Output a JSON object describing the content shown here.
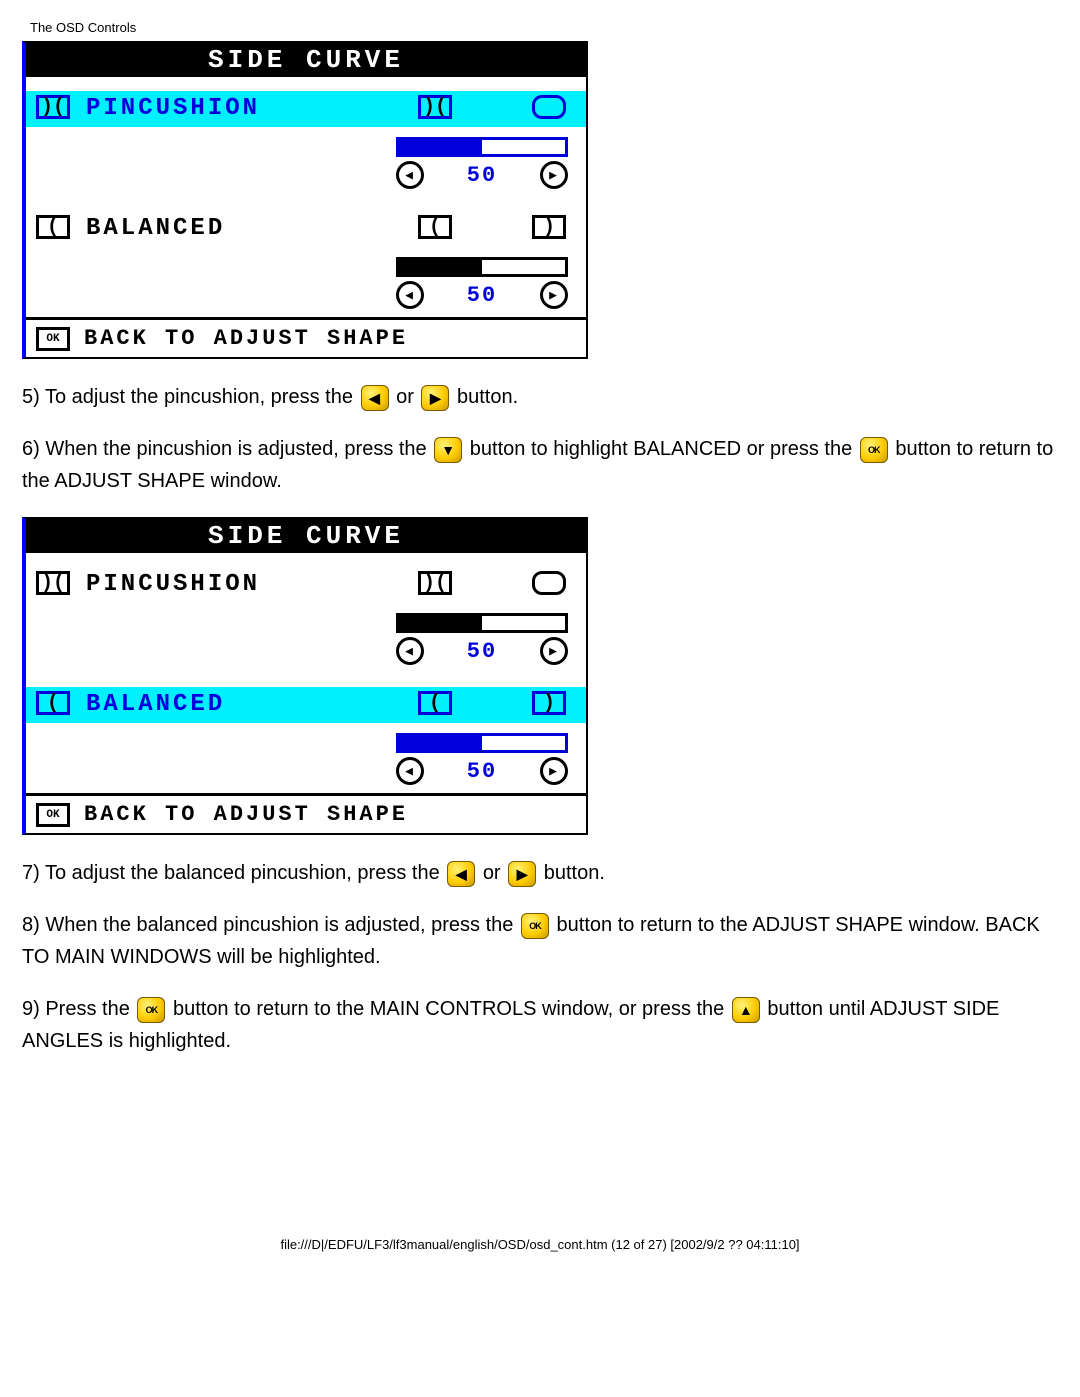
{
  "header": "The OSD Controls",
  "osd1": {
    "title": "SIDE CURVE",
    "items": [
      {
        "label": "PINCUSHION",
        "value": "50",
        "highlight": true
      },
      {
        "label": "BALANCED",
        "value": "50",
        "highlight": false
      }
    ],
    "back": "BACK TO ADJUST SHAPE",
    "ok": "OK"
  },
  "osd2": {
    "title": "SIDE CURVE",
    "items": [
      {
        "label": "PINCUSHION",
        "value": "50",
        "highlight": false
      },
      {
        "label": "BALANCED",
        "value": "50",
        "highlight": true
      }
    ],
    "back": "BACK TO ADJUST SHAPE",
    "ok": "OK"
  },
  "p5a": "5) To adjust the pincushion, press the ",
  "p5b": " or ",
  "p5c": " button.",
  "p6a": "6) When the pincushion is adjusted, press the ",
  "p6b": " button to highlight BALANCED or press the ",
  "p6c": " button to return to the ADJUST SHAPE window.",
  "p7a": "7) To adjust the balanced pincushion, press the ",
  "p7b": " or ",
  "p7c": " button.",
  "p8a": "8) When the balanced pincushion is adjusted, press the ",
  "p8b": " button to return to the ADJUST SHAPE window. BACK TO MAIN WINDOWS will be highlighted.",
  "p9a": "9) Press the ",
  "p9b": " button to return to the MAIN CONTROLS window, or press the ",
  "p9c": " button until ADJUST SIDE ANGLES is highlighted.",
  "btn": {
    "ok": "OK",
    "left": "◀",
    "right": "▶",
    "down": "▼",
    "up": "▲"
  },
  "footer": "file:///D|/EDFU/LF3/lf3manual/english/OSD/osd_cont.htm (12 of 27) [2002/9/2 ?? 04:11:10]"
}
